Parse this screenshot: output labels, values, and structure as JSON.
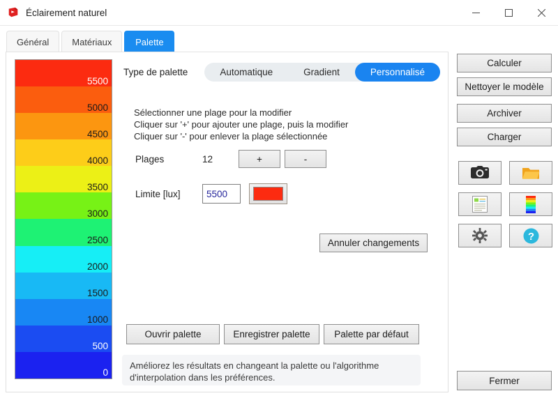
{
  "window": {
    "title": "Éclairement naturel",
    "app_icon": "sketchup-icon",
    "controls": {
      "minimize": "–",
      "maximize": "▢",
      "close": "✕"
    }
  },
  "tabs": [
    {
      "label": "Général",
      "active": false
    },
    {
      "label": "Matériaux",
      "active": false
    },
    {
      "label": "Palette",
      "active": true
    }
  ],
  "palette_legend": {
    "bands": [
      {
        "label": "5500",
        "color": "#fc2b10",
        "label_color": "#ffffff"
      },
      {
        "label": "5000",
        "color": "#fb5d0e",
        "label_color": "#1a1a1a"
      },
      {
        "label": "4500",
        "color": "#fc9610",
        "label_color": "#1a1a1a"
      },
      {
        "label": "4000",
        "color": "#fdcd19",
        "label_color": "#1a1a1a"
      },
      {
        "label": "3500",
        "color": "#ecf016",
        "label_color": "#1a1a1a"
      },
      {
        "label": "3000",
        "color": "#77f216",
        "label_color": "#1a1a1a"
      },
      {
        "label": "2500",
        "color": "#1ef274",
        "label_color": "#1a1a1a"
      },
      {
        "label": "2000",
        "color": "#16eef6",
        "label_color": "#1a1a1a"
      },
      {
        "label": "1500",
        "color": "#18b9f5",
        "label_color": "#1a1a1a"
      },
      {
        "label": "1000",
        "color": "#1887f4",
        "label_color": "#1a1a1a"
      },
      {
        "label": "500",
        "color": "#1b4cf2",
        "label_color": "#ffffff"
      },
      {
        "label": "0",
        "color": "#1b22f0",
        "label_color": "#ffffff"
      }
    ]
  },
  "form": {
    "type_label": "Type de palette",
    "type_options": [
      {
        "label": "Automatique",
        "active": false
      },
      {
        "label": "Gradient",
        "active": false
      },
      {
        "label": "Personnalisé",
        "active": true
      }
    ],
    "instructions": [
      "Sélectionner une plage pour la modifier",
      "Cliquer sur '+' pour ajouter une plage, puis la modifier",
      "Cliquer sur '-' pour enlever la plage sélectionnée"
    ],
    "plages_label": "Plages",
    "plages_value": "12",
    "plages_add": "+",
    "plages_remove": "-",
    "limite_label": "Limite [lux]",
    "limite_value": "5500",
    "limite_placeholder": "5500",
    "limite_swatch_color": "#fc2b10",
    "cancel_changes": "Annuler changements",
    "open_palette": "Ouvrir palette",
    "save_palette": "Enregistrer palette",
    "default_palette": "Palette par défaut",
    "info_message": "Améliorez les résultats en changeant la palette ou l'algorithme d'interpolation dans les préférences."
  },
  "sidebar": {
    "buttons": [
      "Calculer",
      "Nettoyer le modèle",
      "Archiver",
      "Charger"
    ],
    "icons": [
      "camera-icon",
      "folder-icon",
      "report-icon",
      "color-ramp-icon",
      "gear-icon",
      "help-icon"
    ],
    "close": "Fermer"
  },
  "colors": {
    "accent": "#1a8cf0",
    "panel_border": "#dfdfdf",
    "info_bg": "#f4f5f7"
  }
}
